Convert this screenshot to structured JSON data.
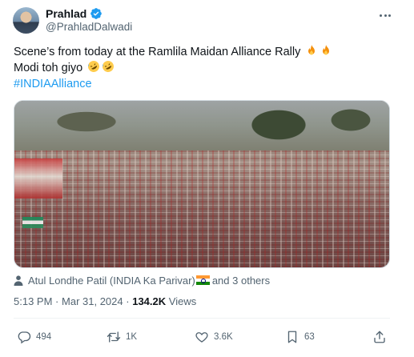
{
  "author": {
    "display_name": "Prahlad",
    "handle": "@PrahladDalwadi",
    "verified": true
  },
  "tweet": {
    "line1": "Scene’s from today at the Ramlila Maidan Alliance Rally",
    "line1_emojis": [
      "fire",
      "fire"
    ],
    "line2": "Modi toh giyo",
    "line2_emojis": [
      "rolling-on-floor-laughing",
      "rolling-on-floor-laughing"
    ],
    "hashtag": "#INDIAAlliance"
  },
  "media": {
    "description_icon": "crowd-photo"
  },
  "social_context": {
    "names": "Atul Londhe Patil (INDIA Ka Parivar)",
    "suffix": "and 3 others"
  },
  "meta": {
    "time": "5:13 PM",
    "separator": "·",
    "date": "Mar 31, 2024",
    "views_count": "134.2K",
    "views_label": "Views"
  },
  "actions": {
    "replies": "494",
    "reposts": "1K",
    "likes": "3.6K",
    "bookmarks": "63"
  },
  "colors": {
    "accent": "#1d9bf0",
    "text_primary": "#0f1419",
    "text_secondary": "#536471"
  }
}
